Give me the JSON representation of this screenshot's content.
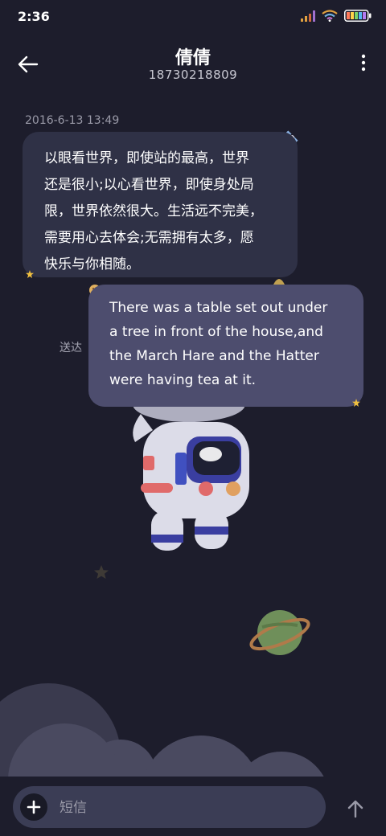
{
  "status_bar": {
    "time": "2:36",
    "icons": [
      "signal-icon",
      "wifi-icon",
      "battery-icon"
    ]
  },
  "header": {
    "title": "倩倩",
    "subtitle": "18730218809",
    "back_icon": "arrow-left-icon",
    "more_icon": "more-vertical-icon"
  },
  "conversation": {
    "timestamp": "2016-6-13 13:49",
    "incoming": {
      "lines": [
        "以眼看世界，即使站的最高，世界",
        "还是很小;以心看世界，即使身处局",
        "限，世界依然很大。生活远不完美，",
        "需要用心去体会;无需拥有太多，愿",
        "快乐与你相随。"
      ]
    },
    "outgoing": {
      "lines": [
        "There was a table set out under",
        "a tree in front of the house,and",
        "the March Hare and the Hatter",
        "were having tea at it."
      ],
      "status": "送达"
    }
  },
  "composer": {
    "placeholder": "短信",
    "add_icon": "plus-icon",
    "send_icon": "arrow-up-icon"
  },
  "colors": {
    "background": "#1d1d2c",
    "incoming_bubble": "#2f3146",
    "outgoing_bubble": "#4d4d6e",
    "input_pill": "#3b3d55"
  }
}
